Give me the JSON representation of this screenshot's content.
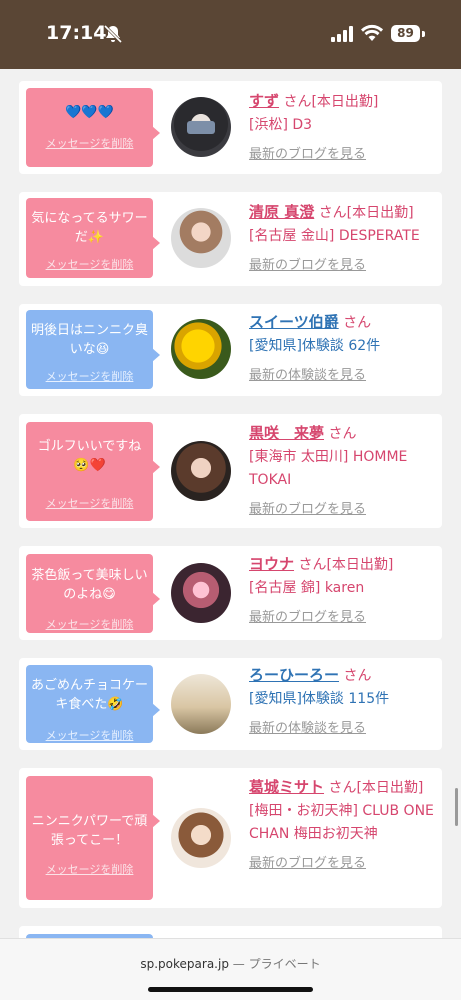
{
  "status_bar": {
    "time": "17:14",
    "battery": "89"
  },
  "cards": [
    {
      "bubble": "💙💙💙",
      "bubble_color": "pink",
      "delete": "メッセージを削除",
      "name": "すず",
      "suffix": "さん[本日出勤]",
      "detail": "[浜松] D3",
      "link": "最新のブログを見る",
      "link_type": "blog"
    },
    {
      "bubble": "気になってるサワーだ✨",
      "bubble_color": "pink",
      "delete": "メッセージを削除",
      "name": "清原 真澄",
      "suffix": "さん[本日出勤]",
      "detail": "[名古屋 金山] DESPERATE",
      "link": "最新のブログを見る",
      "link_type": "blog"
    },
    {
      "bubble": "明後日はニンニク臭いな😆",
      "bubble_color": "blue",
      "delete": "メッセージを削除",
      "name": "スイーツ伯爵",
      "suffix": "さん",
      "detail": "[愛知県]体験談 62件",
      "link": "最新の体験談を見る",
      "link_type": "review"
    },
    {
      "bubble": "ゴルフいいですね🥺❤️",
      "bubble_color": "pink",
      "delete": "メッセージを削除",
      "name": "黒咲　来夢",
      "suffix": "さん",
      "detail": "[東海市 太田川] HOMME TOKAI",
      "link": "最新のブログを見る",
      "link_type": "blog"
    },
    {
      "bubble": "茶色飯って美味しいのよね😋",
      "bubble_color": "pink",
      "delete": "メッセージを削除",
      "name": "ヨウナ",
      "suffix": "さん[本日出勤]",
      "detail": "[名古屋 錦] karen",
      "link": "最新のブログを見る",
      "link_type": "blog"
    },
    {
      "bubble": "あごめんチョコケーキ食べた🤣",
      "bubble_color": "blue",
      "delete": "メッセージを削除",
      "name": "ろーひーろー",
      "suffix": "さん",
      "detail": "[愛知県]体験談 115件",
      "link": "最新の体験談を見る",
      "link_type": "review"
    },
    {
      "bubble": "ニンニクパワーで頑張ってこー！",
      "bubble_color": "pink",
      "delete": "メッセージを削除",
      "name": "葛城ミサト",
      "suffix": "さん[本日出勤]",
      "detail": "[梅田・お初天神] CLUB ONE CHAN 梅田お初天神",
      "link": "最新のブログを見る",
      "link_type": "blog"
    }
  ],
  "browser": {
    "domain": "sp.pokepara.jp",
    "separator": " — ",
    "privacy": "プライベート"
  },
  "colors": {
    "header": "#5a4635",
    "bubble_pink": "#f68b9f",
    "bubble_blue": "#8ab6f2",
    "name_pink": "#d6466e",
    "name_blue": "#2f73b4"
  }
}
